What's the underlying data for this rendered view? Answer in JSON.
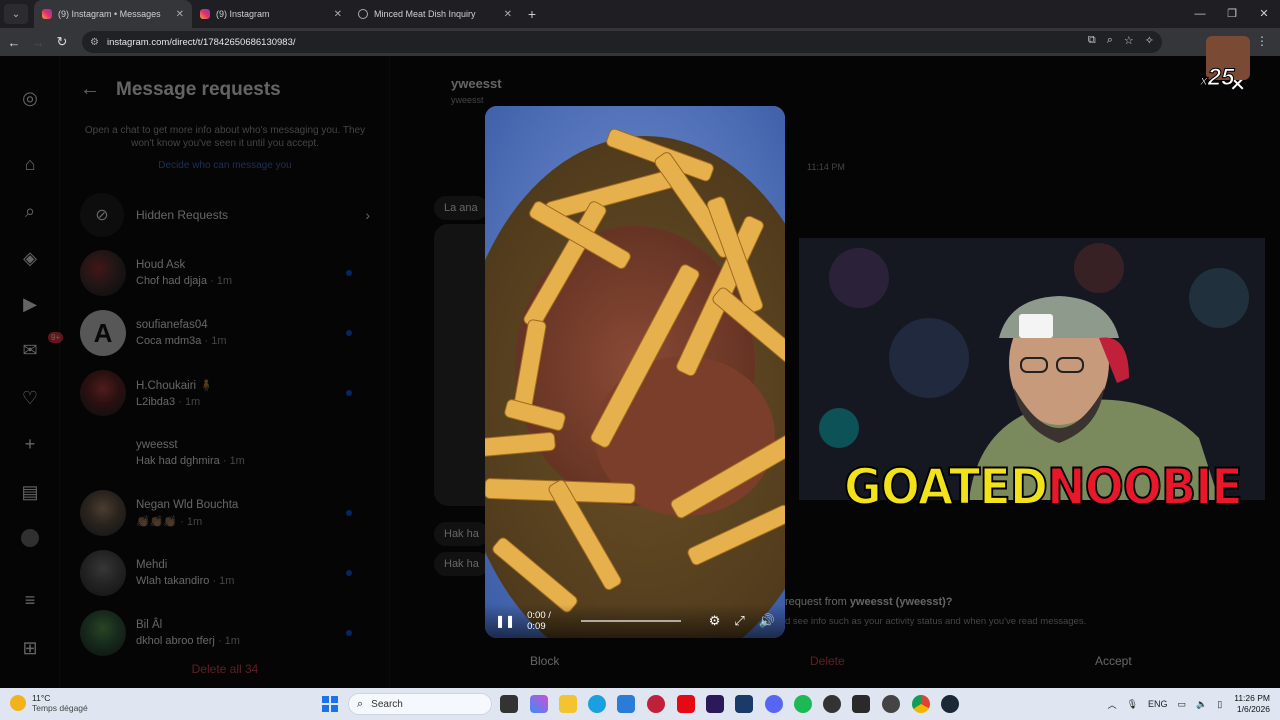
{
  "browser": {
    "tabs": [
      {
        "title": "(9) Instagram • Messages",
        "active": true
      },
      {
        "title": "(9) Instagram",
        "active": false
      },
      {
        "title": "Minced Meat Dish Inquiry",
        "active": false
      }
    ],
    "url": "instagram.com/direct/t/17842650686130983/"
  },
  "sidebar": {
    "notification_badge": "9+"
  },
  "requests": {
    "title": "Message requests",
    "info": "Open a chat to get more info about who's messaging you. They won't know you've seen it until you accept.",
    "link": "Decide who can message you",
    "hidden_label": "Hidden Requests",
    "items": [
      {
        "name": "Houd Ask",
        "message": "Chof had djaja",
        "time": "· 1m"
      },
      {
        "name": "soufianefas04",
        "message": "Coca mdm3a",
        "time": "· 1m"
      },
      {
        "name": "H.Choukairi 🧍",
        "message": "L2ibda3",
        "time": "· 1m"
      },
      {
        "name": "yweesst",
        "message": "Hak had dghmira",
        "time": "· 1m"
      },
      {
        "name": "Negan Wld Bouchta",
        "message": "👏🏽👏🏽👏🏽",
        "time": "· 1m"
      },
      {
        "name": "Mehdi",
        "message": "Wlah takandiro",
        "time": "· 1m"
      },
      {
        "name": "Bil Âl",
        "message": "dkhol abroo tferj",
        "time": "· 1m"
      }
    ],
    "delete_all": "Delete all 34"
  },
  "chat": {
    "name": "yweesst",
    "username": "yweesst",
    "time": "11:14 PM",
    "bubble1": "La ana",
    "bubble2": "Hak ha",
    "bubble3": "Hak ha",
    "question_prefix": "request from ",
    "question_user": "yweesst (yweesst)?",
    "info": "d see info such as your activity status and when you've read messages.",
    "block": "Block",
    "delete": "Delete",
    "accept": "Accept"
  },
  "video": {
    "time": "0:00 / 0:09",
    "progress": 0
  },
  "overlay": {
    "brand_part1": "GOATED",
    "brand_part2": "NOOBIE",
    "multiplier_prefix": "x",
    "multiplier": "25"
  },
  "taskbar": {
    "temp": "11°C",
    "weather": "Temps dégagé",
    "search": "Search",
    "lang": "ENG",
    "time": "11:26 PM",
    "date": "1/6/2026"
  }
}
